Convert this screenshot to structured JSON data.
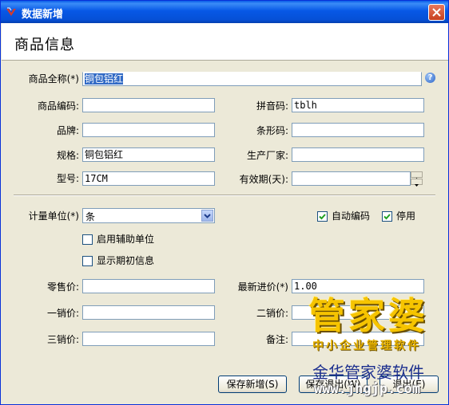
{
  "window": {
    "title": "数据新增"
  },
  "header": {
    "title": "商品信息"
  },
  "form": {
    "full_name": {
      "label": "商品全称(*)",
      "value": "铜包铝红"
    },
    "code": {
      "label": "商品编码:",
      "value": ""
    },
    "pinyin": {
      "label": "拼音码:",
      "value": "tblh"
    },
    "brand": {
      "label": "品牌:",
      "value": ""
    },
    "barcode": {
      "label": "条形码:",
      "value": ""
    },
    "spec": {
      "label": "规格:",
      "value": "铜包铝红"
    },
    "maker": {
      "label": "生产厂家:",
      "value": ""
    },
    "model": {
      "label": "型号:",
      "value": "17CM"
    },
    "shelf_life": {
      "label": "有效期(天):",
      "value": ""
    },
    "unit": {
      "label": "计量单位(*)",
      "value": "条"
    },
    "auto_code": {
      "label": "自动编码",
      "checked": true
    },
    "disabled": {
      "label": "停用",
      "checked": true
    },
    "aux_unit": {
      "label": "启用辅助单位",
      "checked": false
    },
    "show_initial": {
      "label": "显示期初信息",
      "checked": false
    },
    "retail_price": {
      "label": "零售价:",
      "value": ""
    },
    "latest_price": {
      "label": "最新进价(*)",
      "value": "1.00"
    },
    "price1": {
      "label": "一销价:",
      "value": ""
    },
    "price2": {
      "label": "二销价:",
      "value": ""
    },
    "price3": {
      "label": "三销价:",
      "value": ""
    },
    "remark": {
      "label": "备注:",
      "value": ""
    }
  },
  "buttons": {
    "save_new": "保存新增(S)",
    "save_exit": "保存退出(W)",
    "exit": "退出(E)"
  },
  "watermark": {
    "big": "管家婆",
    "sub": "中小企业管理软件",
    "brand": "金华管家婆软件",
    "url": "www.jhgjp.com"
  }
}
